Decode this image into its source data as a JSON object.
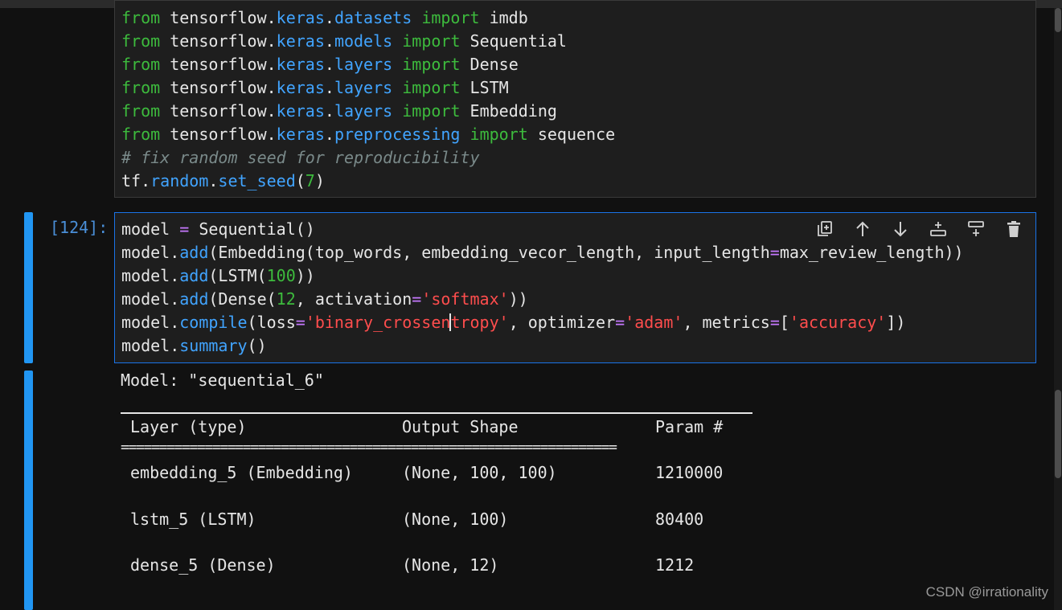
{
  "cell1": {
    "lines": [
      [
        {
          "t": "from",
          "c": "k"
        },
        {
          "t": " tensorflow.",
          "c": "n"
        },
        {
          "t": "keras",
          "c": "m"
        },
        {
          "t": ".",
          "c": "n"
        },
        {
          "t": "datasets",
          "c": "m"
        },
        {
          "t": " ",
          "c": "n"
        },
        {
          "t": "import",
          "c": "k"
        },
        {
          "t": " imdb",
          "c": "n"
        }
      ],
      [
        {
          "t": "from",
          "c": "k"
        },
        {
          "t": " tensorflow.",
          "c": "n"
        },
        {
          "t": "keras",
          "c": "m"
        },
        {
          "t": ".",
          "c": "n"
        },
        {
          "t": "models",
          "c": "m"
        },
        {
          "t": " ",
          "c": "n"
        },
        {
          "t": "import",
          "c": "k"
        },
        {
          "t": " Sequential",
          "c": "n"
        }
      ],
      [
        {
          "t": "from",
          "c": "k"
        },
        {
          "t": " tensorflow.",
          "c": "n"
        },
        {
          "t": "keras",
          "c": "m"
        },
        {
          "t": ".",
          "c": "n"
        },
        {
          "t": "layers",
          "c": "m"
        },
        {
          "t": " ",
          "c": "n"
        },
        {
          "t": "import",
          "c": "k"
        },
        {
          "t": " Dense",
          "c": "n"
        }
      ],
      [
        {
          "t": "from",
          "c": "k"
        },
        {
          "t": " tensorflow.",
          "c": "n"
        },
        {
          "t": "keras",
          "c": "m"
        },
        {
          "t": ".",
          "c": "n"
        },
        {
          "t": "layers",
          "c": "m"
        },
        {
          "t": " ",
          "c": "n"
        },
        {
          "t": "import",
          "c": "k"
        },
        {
          "t": " LSTM",
          "c": "n"
        }
      ],
      [
        {
          "t": "from",
          "c": "k"
        },
        {
          "t": " tensorflow.",
          "c": "n"
        },
        {
          "t": "keras",
          "c": "m"
        },
        {
          "t": ".",
          "c": "n"
        },
        {
          "t": "layers",
          "c": "m"
        },
        {
          "t": " ",
          "c": "n"
        },
        {
          "t": "import",
          "c": "k"
        },
        {
          "t": " Embedding",
          "c": "n"
        }
      ],
      [
        {
          "t": "from",
          "c": "k"
        },
        {
          "t": " tensorflow.",
          "c": "n"
        },
        {
          "t": "keras",
          "c": "m"
        },
        {
          "t": ".",
          "c": "n"
        },
        {
          "t": "preprocessing",
          "c": "m"
        },
        {
          "t": " ",
          "c": "n"
        },
        {
          "t": "import",
          "c": "k"
        },
        {
          "t": " sequence",
          "c": "n"
        }
      ],
      [
        {
          "t": "# fix random seed for reproducibility",
          "c": "c"
        }
      ],
      [
        {
          "t": "tf.",
          "c": "n"
        },
        {
          "t": "random",
          "c": "m"
        },
        {
          "t": ".",
          "c": "n"
        },
        {
          "t": "set_seed",
          "c": "m"
        },
        {
          "t": "(",
          "c": "n"
        },
        {
          "t": "7",
          "c": "num"
        },
        {
          "t": ")",
          "c": "n"
        }
      ]
    ]
  },
  "cell2": {
    "prompt": "[124]:",
    "lines": [
      [
        {
          "t": "model ",
          "c": "n"
        },
        {
          "t": "=",
          "c": "op"
        },
        {
          "t": " Sequential()",
          "c": "n"
        }
      ],
      [
        {
          "t": "model.",
          "c": "n"
        },
        {
          "t": "add",
          "c": "m"
        },
        {
          "t": "(Embedding(top_words, embedding_vecor_length, input_length",
          "c": "n"
        },
        {
          "t": "=",
          "c": "op"
        },
        {
          "t": "max_review_length))",
          "c": "n"
        }
      ],
      [
        {
          "t": "model.",
          "c": "n"
        },
        {
          "t": "add",
          "c": "m"
        },
        {
          "t": "(LSTM(",
          "c": "n"
        },
        {
          "t": "100",
          "c": "num"
        },
        {
          "t": "))",
          "c": "n"
        }
      ],
      [
        {
          "t": "model.",
          "c": "n"
        },
        {
          "t": "add",
          "c": "m"
        },
        {
          "t": "(Dense(",
          "c": "n"
        },
        {
          "t": "12",
          "c": "num"
        },
        {
          "t": ", activation",
          "c": "n"
        },
        {
          "t": "=",
          "c": "op"
        },
        {
          "t": "'softmax'",
          "c": "s"
        },
        {
          "t": "))",
          "c": "n"
        }
      ],
      [
        {
          "t": "model.",
          "c": "n"
        },
        {
          "t": "compile",
          "c": "m"
        },
        {
          "t": "(loss",
          "c": "n"
        },
        {
          "t": "=",
          "c": "op"
        },
        {
          "t": "'binary_crossen",
          "c": "s"
        },
        {
          "t": "|",
          "c": "cursor"
        },
        {
          "t": "tropy'",
          "c": "s"
        },
        {
          "t": ", optimizer",
          "c": "n"
        },
        {
          "t": "=",
          "c": "op"
        },
        {
          "t": "'adam'",
          "c": "s"
        },
        {
          "t": ", metrics",
          "c": "n"
        },
        {
          "t": "=",
          "c": "op"
        },
        {
          "t": "[",
          "c": "n"
        },
        {
          "t": "'accuracy'",
          "c": "s"
        },
        {
          "t": "])",
          "c": "n"
        }
      ],
      [
        {
          "t": "model.",
          "c": "n"
        },
        {
          "t": "summary",
          "c": "m"
        },
        {
          "t": "()",
          "c": "n"
        }
      ]
    ],
    "toolbar": [
      "duplicate-icon",
      "arrow-up-icon",
      "arrow-down-icon",
      "insert-above-icon",
      "insert-below-icon",
      "trash-icon"
    ]
  },
  "output": {
    "model_line": "Model: \"sequential_6\"",
    "headers": {
      "layer": "Layer (type)",
      "shape": "Output Shape",
      "params": "Param #"
    },
    "equals_rule": "=================================================================",
    "rows": [
      {
        "layer": "embedding_5 (Embedding)",
        "shape": "(None, 100, 100)",
        "params": "1210000"
      },
      {
        "layer": "lstm_5 (LSTM)",
        "shape": "(None, 100)",
        "params": "80400"
      },
      {
        "layer": "dense_5 (Dense)",
        "shape": "(None, 12)",
        "params": "1212"
      }
    ]
  },
  "watermark": "CSDN @irrationality",
  "colors": {
    "accent": "#2196f3",
    "keyword": "#3dbb3d",
    "module": "#41a4ff",
    "string": "#ff4d4d"
  }
}
